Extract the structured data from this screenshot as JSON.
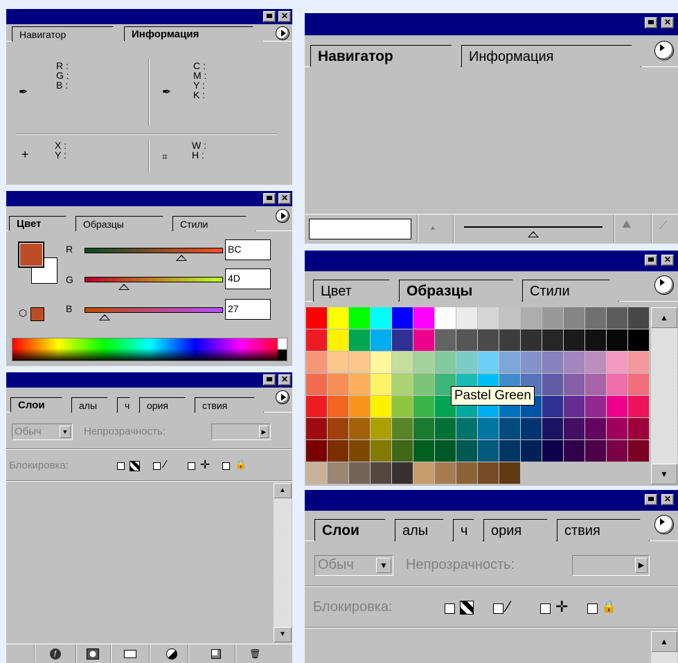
{
  "info_panel": {
    "tabs": [
      "Навигатор",
      "Информация"
    ],
    "rgb_labels": [
      "R :",
      "G :",
      "B :"
    ],
    "cmyk_labels": [
      "C :",
      "M :",
      "Y :",
      "K :"
    ],
    "xy_labels": [
      "X :",
      "Y :"
    ],
    "wh_labels": [
      "W :",
      "H :"
    ]
  },
  "color_panel": {
    "tabs": [
      "Цвет",
      "Образцы",
      "Стили"
    ],
    "channels": [
      {
        "label": "R",
        "value": "BC"
      },
      {
        "label": "G",
        "value": "4D"
      },
      {
        "label": "B",
        "value": "27"
      }
    ],
    "foreground_color": "#BC4D27",
    "background_color": "#FFFFFF"
  },
  "layers_panel_left": {
    "tabs": [
      "Слои",
      "алы",
      "ч",
      "ория",
      "ствия"
    ],
    "blend_mode": "Обыч",
    "opacity_label": "Непрозрачность:",
    "lock_label": "Блокировка:",
    "bottom_icons": [
      "layer-style-icon",
      "mask-icon",
      "folder-icon",
      "adjustment-icon",
      "new-layer-icon",
      "trash-icon"
    ]
  },
  "navigator_panel": {
    "tabs": [
      "Навигатор",
      "Информация"
    ],
    "zoom_value": ""
  },
  "swatches_panel": {
    "tabs": [
      "Цвет",
      "Образцы",
      "Стили"
    ],
    "tooltip": "Pastel Green",
    "rows": [
      [
        "#ff0000",
        "#ffff00",
        "#00ff00",
        "#00ffff",
        "#0000ff",
        "#ff00ff",
        "#ffffff",
        "#ebebeb",
        "#d6d6d6",
        "#c2c2c2",
        "#adadad",
        "#999999",
        "#858585",
        "#707070",
        "#5c5c5c",
        "#474747"
      ],
      [
        "#ed1c24",
        "#fff200",
        "#00a651",
        "#00aeef",
        "#2e3192",
        "#ec008c",
        "#636363",
        "#565656",
        "#4a4a4a",
        "#3d3d3d",
        "#313131",
        "#262626",
        "#1b1b1b",
        "#111111",
        "#080808",
        "#000000"
      ],
      [
        "#f69679",
        "#fdc68a",
        "#fdc68a",
        "#fff799",
        "#c4df9b",
        "#a3d39c",
        "#82ca9d",
        "#7accc8",
        "#6dcff6",
        "#7da7d9",
        "#8393ca",
        "#8781bd",
        "#a187be",
        "#bd8cbf",
        "#f49ac1",
        "#f5989d"
      ],
      [
        "#f26c4f",
        "#f68e55",
        "#fbaf5d",
        "#fff467",
        "#acd372",
        "#7cc576",
        "#3bb878",
        "#1abbb4",
        "#00bff3",
        "#438ccb",
        "#5574b9",
        "#605ca8",
        "#8560a8",
        "#a864a8",
        "#f06ea9",
        "#f26d7d"
      ],
      [
        "#ed1c24",
        "#f26522",
        "#f7941d",
        "#fff200",
        "#8dc63f",
        "#39b54a",
        "#00a651",
        "#00a99d",
        "#00aeef",
        "#0072bc",
        "#0054a6",
        "#2e3192",
        "#662d91",
        "#92278f",
        "#ec008c",
        "#ed145b"
      ],
      [
        "#9e0b0f",
        "#a0410d",
        "#a36209",
        "#aba000",
        "#598527",
        "#1a7b30",
        "#007236",
        "#00746b",
        "#0076a3",
        "#004b80",
        "#003471",
        "#1b1464",
        "#440e62",
        "#630460",
        "#9e005d",
        "#9e0039"
      ],
      [
        "#790000",
        "#7b2e00",
        "#7d4900",
        "#827b00",
        "#406618",
        "#005e20",
        "#005826",
        "#005952",
        "#005b7f",
        "#003663",
        "#002157",
        "#0d004c",
        "#32004b",
        "#4b0049",
        "#7b0046",
        "#7a0026"
      ],
      [
        "#c7b299",
        "#998675",
        "#736357",
        "#534741",
        "#37302d",
        "#c69c6d",
        "#a67c52",
        "#8c6239",
        "#754c24",
        "#603913"
      ]
    ]
  },
  "layers_panel_right": {
    "tabs": [
      "Слои",
      "алы",
      "ч",
      "ория",
      "ствия"
    ],
    "blend_mode": "Обыч",
    "opacity_label": "Непрозрачность:",
    "lock_label": "Блокировка:"
  }
}
